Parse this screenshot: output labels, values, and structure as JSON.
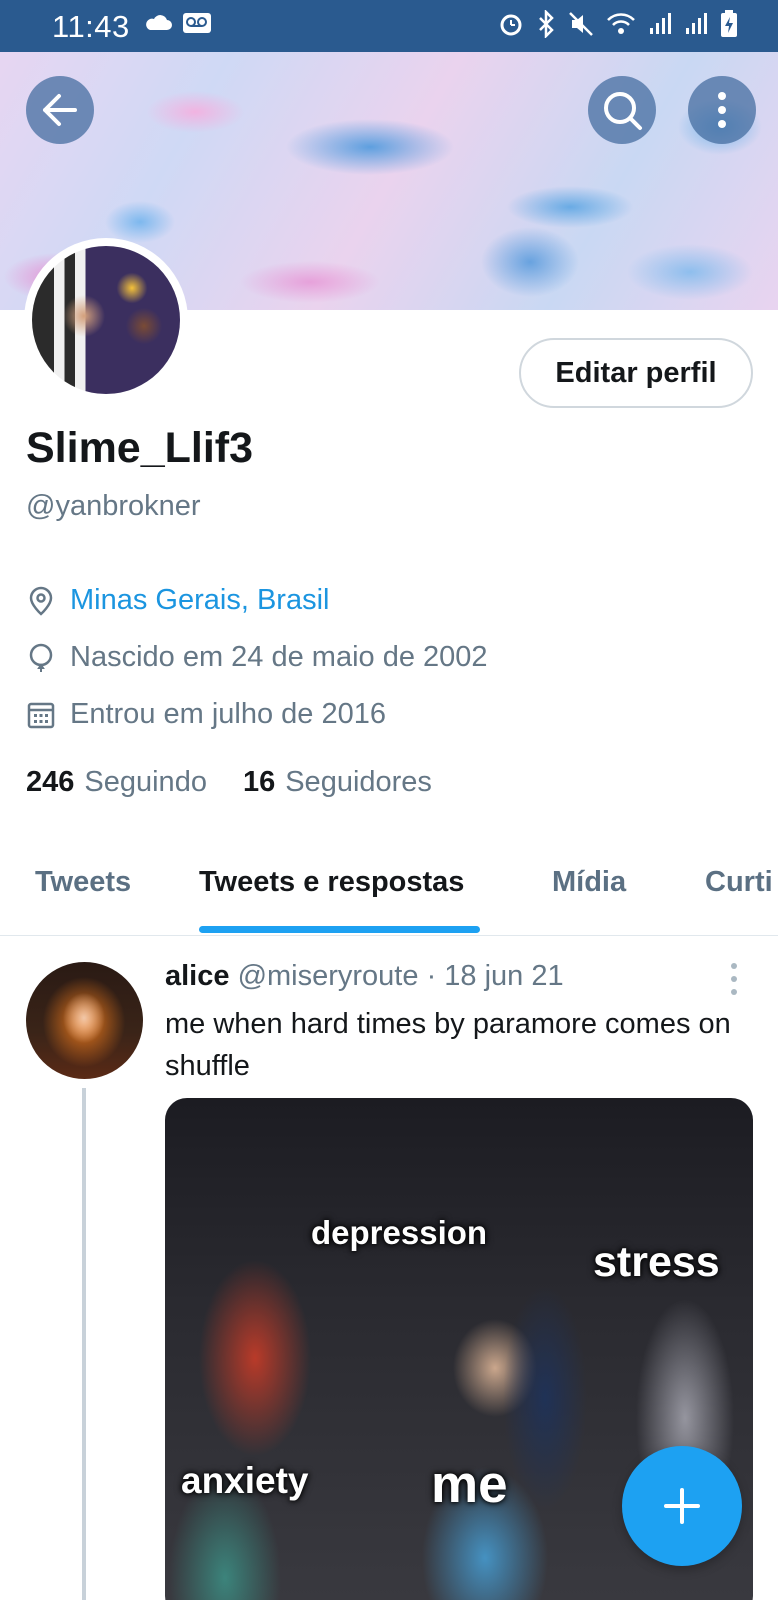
{
  "status_bar": {
    "time": "11:43"
  },
  "profile": {
    "edit_button_label": "Editar perfil",
    "display_name": "Slime_Llif3",
    "handle": "@yanbrokner",
    "location": "Minas Gerais, Brasil",
    "birthday": "Nascido em 24 de maio de 2002",
    "joined": "Entrou em julho de 2016",
    "following_count": "246",
    "following_label": "Seguindo",
    "followers_count": "16",
    "followers_label": "Seguidores"
  },
  "tabs": [
    {
      "label": "Tweets",
      "active": false
    },
    {
      "label": "Tweets e respostas",
      "active": true
    },
    {
      "label": "Mídia",
      "active": false
    },
    {
      "label": "Curti",
      "active": false
    }
  ],
  "tweet": {
    "author_name": "alice",
    "author_handle": "@miseryroute",
    "separator": "·",
    "date": "18 jun 21",
    "text": "me when hard times by paramore comes on shuffle",
    "image_captions": {
      "depression": "depression",
      "stress": "stress",
      "anxiety": "anxiety",
      "me": "me"
    }
  },
  "colors": {
    "accent": "#1da1f2",
    "link": "#1b95e0",
    "status_bar": "#2a5a8f",
    "muted_text": "#657786"
  },
  "icons": {
    "back": "arrow-left-icon",
    "search": "search-icon",
    "more": "more-vertical-icon",
    "location": "location-pin-icon",
    "birthday": "balloon-icon",
    "joined": "calendar-icon",
    "compose": "plus-icon"
  }
}
